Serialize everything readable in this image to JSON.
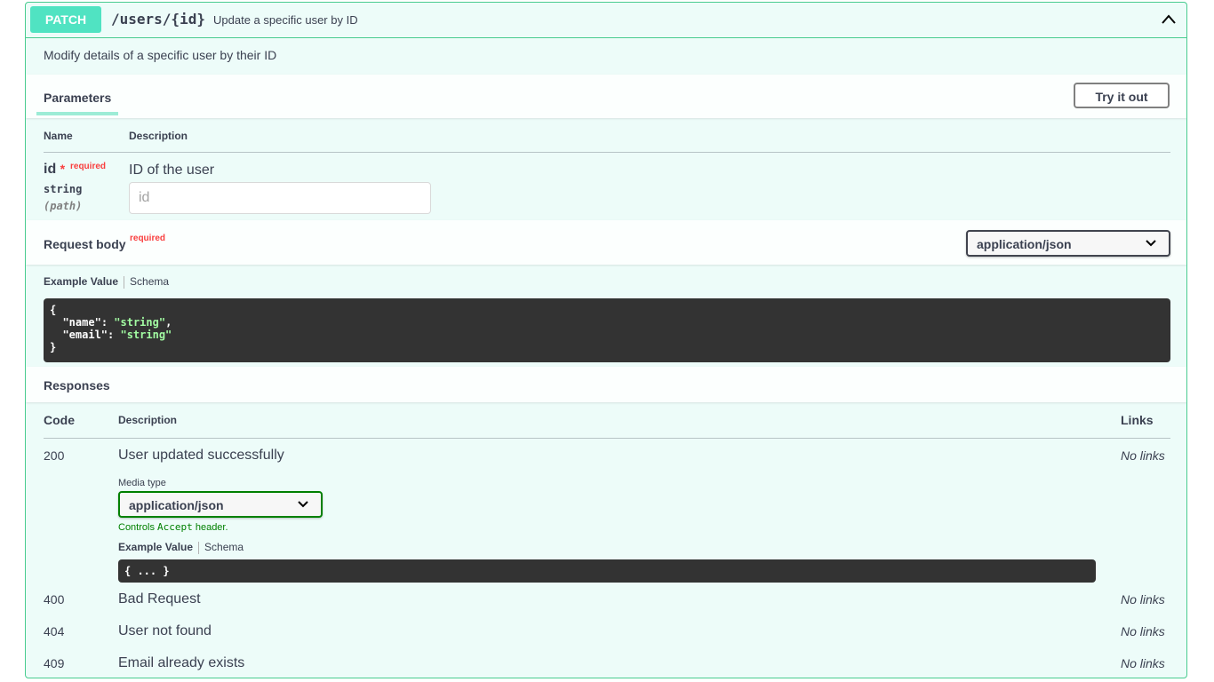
{
  "operation": {
    "method": "PATCH",
    "path": "/users/{id}",
    "summary": "Update a specific user by ID",
    "description": "Modify details of a specific user by their ID",
    "icons": {
      "collapse": "chevron-up-icon"
    },
    "colors": {
      "accent": "#49cc90",
      "method_bg": "#50e3c2"
    }
  },
  "parameters": {
    "title": "Parameters",
    "try_it_out": "Try it out",
    "col_name": "Name",
    "col_description": "Description",
    "items": [
      {
        "name": "id",
        "star": "*",
        "required_label": "required",
        "type": "string",
        "in": "(path)",
        "description": "ID of the user",
        "placeholder": "id"
      }
    ]
  },
  "request_body": {
    "title": "Request body",
    "required_label": "required",
    "content_type": "application/json",
    "tab_example": "Example Value",
    "tab_schema": "Schema",
    "example": {
      "open": "{",
      "k1": "\"name\"",
      "v1": "\"string\"",
      "k2": "\"email\"",
      "v2": "\"string\"",
      "close": "}"
    }
  },
  "responses": {
    "title": "Responses",
    "col_code": "Code",
    "col_description": "Description",
    "col_links": "Links",
    "media_type_label": "Media type",
    "media_type_value": "application/json",
    "controls_prefix": "Controls ",
    "controls_code": "Accept",
    "controls_suffix": " header.",
    "tab_example": "Example Value",
    "tab_schema": "Schema",
    "collapsed_example": "{ ... }",
    "items": [
      {
        "code": "200",
        "description": "User updated successfully",
        "links": "No links"
      },
      {
        "code": "400",
        "description": "Bad Request",
        "links": "No links"
      },
      {
        "code": "404",
        "description": "User not found",
        "links": "No links"
      },
      {
        "code": "409",
        "description": "Email already exists",
        "links": "No links"
      }
    ]
  }
}
